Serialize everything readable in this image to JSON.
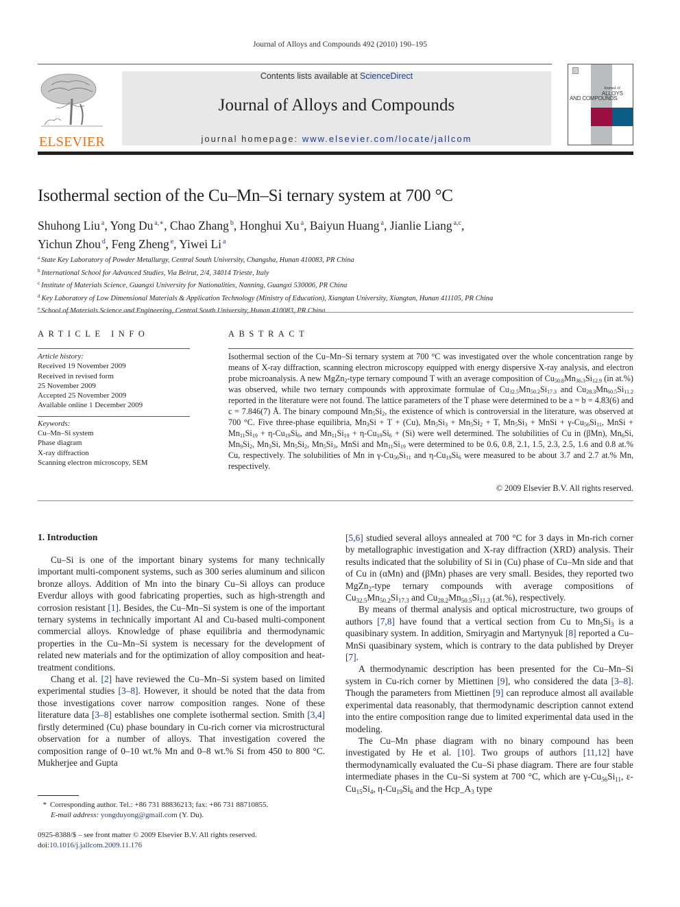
{
  "running_head": "Journal of Alloys and Compounds 492 (2010) 190–195",
  "masthead": {
    "publisher_logo": "ELSEVIER",
    "contents_prefix": "Contents lists available at ",
    "contents_link": "ScienceDirect",
    "journal_title": "Journal of Alloys and Compounds",
    "homepage_prefix": "journal homepage: ",
    "homepage_link": "www.elsevier.com/locate/jallcom",
    "cover": {
      "line1": "Journal of",
      "line2": "ALLOYS",
      "line3": "AND COMPOUNDS",
      "colors": {
        "band": "#b9bcbf",
        "red": "#9c0f45",
        "blue": "#0b5d86"
      }
    }
  },
  "article": {
    "title": "Isothermal section of the Cu–Mn–Si ternary system at 700 °C",
    "authors": [
      {
        "name": "Shuhong Liu",
        "aff": "a"
      },
      {
        "name": "Yong Du",
        "aff": "a,∗"
      },
      {
        "name": "Chao Zhang",
        "aff": "b"
      },
      {
        "name": "Honghui Xu",
        "aff": "a"
      },
      {
        "name": "Baiyun Huang",
        "aff": "a"
      },
      {
        "name": "Jianlie Liang",
        "aff": "a,c"
      },
      {
        "name": "Yichun Zhou",
        "aff": "d"
      },
      {
        "name": "Feng Zheng",
        "aff": "e"
      },
      {
        "name": "Yiwei Li",
        "aff": "a"
      }
    ],
    "affiliations": [
      {
        "mark": "a",
        "text": "State Key Laboratory of Powder Metallurgy, Central South University, Changsha, Hunan 410083, PR China"
      },
      {
        "mark": "b",
        "text": "International School for Advanced Studies, Via Beirut, 2/4, 34014 Trieste, Italy"
      },
      {
        "mark": "c",
        "text": "Institute of Materials Science, Guangxi University for Nationalities, Nanning, Guangxi 530006, PR China"
      },
      {
        "mark": "d",
        "text": "Key Laboratory of Low Dimensional Materials & Application Technology (Ministry of Education), Xiangtan University, Xiangtan, Hunan 411105, PR China"
      },
      {
        "mark": "e",
        "text": "School of Materials Science and Engineering, Central South University, Hunan 410083, PR China"
      }
    ]
  },
  "article_info": {
    "heading": "ARTICLE INFO",
    "history_label": "Article history:",
    "history": [
      "Received 19 November 2009",
      "Received in revised form",
      "25 November 2009",
      "Accepted 25 November 2009",
      "Available online 1 December 2009"
    ],
    "keywords_label": "Keywords:",
    "keywords": [
      "Cu–Mn–Si system",
      "Phase diagram",
      "X-ray diffraction",
      "Scanning electron microscopy, SEM"
    ]
  },
  "abstract": {
    "heading": "ABSTRACT",
    "segments": {
      "s1": "Isothermal section of the Cu–Mn–Si ternary system at 700 °C was investigated over the whole concentration range by means of X-ray diffraction, scanning electron microscopy equipped with energy dispersive X-ray analysis, and electron probe microanalysis. A new MgZn",
      "s2": "-type ternary compound T with an average composition of Cu",
      "s3": "Mn",
      "s4": "Si",
      "s5": " (in at.%) was observed, while two ternary compounds with approximate formulae of Cu",
      "s6": " and Cu",
      "s7": " reported in the literature were not found. The lattice parameters of the T phase were determined to be a = b = 4.83(6) and c = 7.846(7) Å. The binary compound Mn",
      "s8": ", the existence of which is controversial in the literature, was observed at 700 °C. Five three-phase equilibria, Mn",
      "s9": "Si + T + (Cu), Mn",
      "s10": " + T, Mn",
      "s11": " + MnSi + γ-Cu",
      "s12": ", MnSi + Mn",
      "s13": " + η-Cu",
      "s14": ", and Mn",
      "s15": " + (Si) were well determined. The solubilities of Cu in (βMn), Mn",
      "s16": "Si, Mn",
      "s17": ", MnSi and Mn",
      "s18": " were determined to be 0.6, 0.8, 2.1, 1.5, 2.3, 2.5, 1.6 and 0.8 at.% Cu, respectively. The solubilities of Mn in γ-Cu",
      "s19": " and η-Cu",
      "s20": " were measured to be about 3.7 and 2.7 at.% Mn, respectively."
    },
    "subs": {
      "two": "2",
      "three": "3",
      "five": "5",
      "six": "6",
      "nine": "9",
      "eleven": "11",
      "nineteen": "19",
      "fiftysix": "56",
      "cu508": "50.8",
      "mn363": "36.3",
      "si129": "12.9",
      "cu325": "32.5",
      "mn502": "50.2",
      "si173": "17.3",
      "cu283": "28.3",
      "mn605": "60.5",
      "si112": "11.2"
    },
    "copyright": "© 2009 Elsevier B.V. All rights reserved."
  },
  "body": {
    "section_heading": "1.  Introduction",
    "p1": {
      "t1": "Cu–Si is one of the important binary systems for many technically important multi-component systems, such as 300 series aluminum and silicon bronze alloys. Addition of Mn into the binary Cu–Si alloys can produce Everdur alloys with good fabricating properties, such as high-strength and corrosion resistant ",
      "r1": "[1]",
      "t2": ". Besides, the Cu–Mn–Si system is one of the important ternary systems in technically important Al and Cu-based multi-component commercial alloys. Knowledge of phase equilibria and thermodynamic properties in the Cu–Mn–Si system is necessary for the development of related new materials and for the optimization of alloy composition and heat-treatment conditions."
    },
    "p2": {
      "t1": "Chang et al. ",
      "r1": "[2]",
      "t2": " have reviewed the Cu–Mn–Si system based on limited experimental studies ",
      "r2": "[3–8]",
      "t3": ". However, it should be noted that the data from those investigations cover narrow composition ranges. None of these literature data ",
      "r3": "[3–8]",
      "t4": " establishes one complete isothermal section. Smith ",
      "r4": "[3,4]",
      "t5": " firstly determined (Cu) phase boundary in Cu-rich corner via microstructural observation for a number of alloys. That investigation covered the composition range of 0–10 wt.% Mn and 0–8 wt.% Si from 450 to 800 °C. Mukherjee and Gupta ",
      "r5": "[5,6]",
      "t6": " studied several alloys annealed at 700 °C for 3 days in Mn-rich corner by metallographic investigation and X-ray diffraction (XRD) analysis. Their results indicated that the solubility of Si in (Cu) phase of Cu–Mn side and that of Cu in (αMn) and (βMn) phases are very small. Besides, they reported two MgZn",
      "t7": "-type ternary compounds with average compositions of Cu",
      "t8": " and Cu",
      "t9": " (at.%), respectively."
    },
    "p2_subs": {
      "two": "2",
      "cu325": "32.5",
      "mn502": "50.2",
      "si173": "17.3",
      "cu282": "28.2",
      "mn505": "50.5",
      "si113": "11.3"
    },
    "p3": {
      "t1": "By means of thermal analysis and optical microstructure, two groups of authors ",
      "r1": "[7,8]",
      "t2": " have found that a vertical section from Cu to Mn",
      "t3": " is a quasibinary system. In addition, Smiryagin and Martynyuk ",
      "r2": "[8]",
      "t4": " reported a Cu–MnSi quasibinary system, which is contrary to the data published by Dreyer ",
      "r3": "[7]",
      "t5": "."
    },
    "p4": {
      "t1": "A thermodynamic description has been presented for the Cu–Mn–Si system in Cu-rich corner by Miettinen ",
      "r1": "[9]",
      "t2": ", who considered the data ",
      "r2": "[3–8]",
      "t3": ". Though the parameters from Miettinen ",
      "r3": "[9]",
      "t4": " can reproduce almost all available experimental data reasonably, that thermodynamic description cannot extend into the entire composition range due to limited experimental data used in the modeling."
    },
    "p5": {
      "t1": "The Cu–Mn phase diagram with no binary compound has been investigated by He et al. ",
      "r1": "[10]",
      "t2": ". Two groups of authors ",
      "r2": "[11,12]",
      "t3": " have thermodynamically evaluated the Cu–Si phase diagram. There are four stable intermediate phases in the Cu–Si system at 700 °C, which are γ-Cu",
      "t4": ", ε-Cu",
      "t5": ", η-Cu",
      "t6": " and the Hcp_A",
      "t7": " type"
    },
    "p5_subs": {
      "fiftysix": "56",
      "eleven": "11",
      "fifteen": "15",
      "four": "4",
      "nineteen": "19",
      "six": "6",
      "three": "3"
    }
  },
  "footnote": {
    "star": "*",
    "corresponding": "Corresponding author. Tel.: +86 731 88836213; fax: +86 731 88710855.",
    "email_label": "E-mail address: ",
    "email": "yongduyong@gmail.com",
    "email_suffix": " (Y. Du)."
  },
  "front_matter": {
    "line1": "0925-8388/$ – see front matter © 2009 Elsevier B.V. All rights reserved.",
    "doi_prefix": "doi:",
    "doi": "10.1016/j.jallcom.2009.11.176"
  }
}
